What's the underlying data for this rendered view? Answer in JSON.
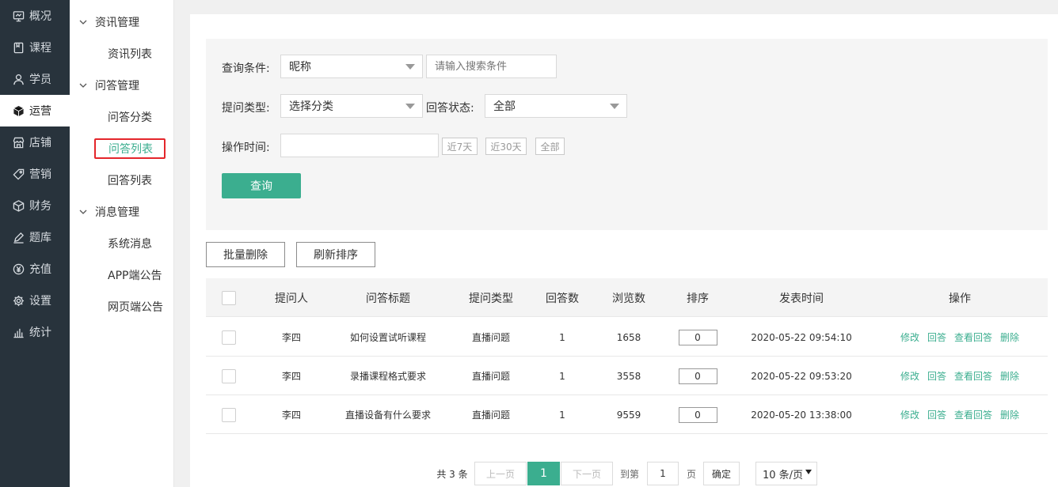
{
  "sidebar": {
    "items": [
      {
        "label": "概况",
        "icon": "monitor-icon"
      },
      {
        "label": "课程",
        "icon": "book-icon"
      },
      {
        "label": "学员",
        "icon": "user-icon"
      },
      {
        "label": "运营",
        "icon": "cube-icon",
        "active": true
      },
      {
        "label": "店铺",
        "icon": "store-icon"
      },
      {
        "label": "营销",
        "icon": "tag-icon"
      },
      {
        "label": "财务",
        "icon": "box-icon"
      },
      {
        "label": "题库",
        "icon": "pencil-icon"
      },
      {
        "label": "充值",
        "icon": "yen-icon"
      },
      {
        "label": "设置",
        "icon": "gear-icon"
      },
      {
        "label": "统计",
        "icon": "bar-chart-icon"
      }
    ]
  },
  "submenu": {
    "groups": [
      {
        "label": "资讯管理",
        "items": [
          "资讯列表"
        ]
      },
      {
        "label": "问答管理",
        "items": [
          "问答分类",
          "问答列表",
          "回答列表"
        ]
      },
      {
        "label": "消息管理",
        "items": [
          "系统消息",
          "APP端公告",
          "网页端公告"
        ]
      }
    ],
    "active_item": "问答列表"
  },
  "filter": {
    "query_label": "查询条件:",
    "query_select": "昵称",
    "search_placeholder": "请输入搜索条件",
    "type_label": "提问类型:",
    "type_select": "选择分类",
    "status_label": "回答状态:",
    "status_select": "全部",
    "time_label": "操作时间:",
    "time_value": "",
    "quick_7": "近7天",
    "quick_30": "近30天",
    "quick_all": "全部",
    "search_button": "查询"
  },
  "toolbar": {
    "batch_delete": "批量删除",
    "refresh_sort": "刷新排序"
  },
  "table": {
    "headers": [
      "提问人",
      "问答标题",
      "提问类型",
      "回答数",
      "浏览数",
      "排序",
      "发表时间",
      "操作"
    ],
    "rows": [
      {
        "asker": "李四",
        "title": "如何设置试听课程",
        "type": "直播问题",
        "answers": "1",
        "views": "1658",
        "sort": "0",
        "time": "2020-05-22 09:54:10"
      },
      {
        "asker": "李四",
        "title": "录播课程格式要求",
        "type": "直播问题",
        "answers": "1",
        "views": "3558",
        "sort": "0",
        "time": "2020-05-22 09:53:20"
      },
      {
        "asker": "李四",
        "title": "直播设备有什么要求",
        "type": "直播问题",
        "answers": "1",
        "views": "9559",
        "sort": "0",
        "time": "2020-05-20 13:38:00"
      }
    ],
    "actions": [
      "修改",
      "回答",
      "查看回答",
      "删除"
    ]
  },
  "pager": {
    "total": "共 3 条",
    "prev": "上一页",
    "current": "1",
    "next": "下一页",
    "goto": "到第",
    "goto_value": "1",
    "page_unit": "页",
    "confirm": "确定",
    "page_size": "10 条/页"
  },
  "colors": {
    "accent": "#3bae8f",
    "sidebar_bg": "#28333c",
    "highlight_border": "#e4262b"
  }
}
